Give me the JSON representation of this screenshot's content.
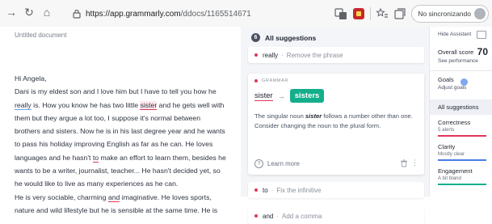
{
  "browser": {
    "url_host": "https://app.grammarly.com",
    "url_path": "/ddocs/1165514671",
    "sync_label": "No sincronizando"
  },
  "document": {
    "title": "Untitled document",
    "lines": [
      {
        "segs": [
          {
            "t": "Hi Angela,"
          }
        ]
      },
      {
        "segs": [
          {
            "t": "Dani is my eldest son and I love him but I have to tell you how he"
          }
        ]
      },
      {
        "segs": [
          {
            "t": "really",
            "u": "blue"
          },
          {
            "t": " is. How you know he has two little "
          },
          {
            "t": "sister",
            "u": "hl"
          },
          {
            "t": " and he gets well with"
          }
        ]
      },
      {
        "segs": [
          {
            "t": "them but they argue a lot too, I suppose it's normal between"
          }
        ]
      },
      {
        "segs": [
          {
            "t": "brothers and sisters. Now he is in his last degree year and he wants"
          }
        ]
      },
      {
        "segs": [
          {
            "t": "to pass his holiday improving English as far as he can. He loves"
          }
        ]
      },
      {
        "segs": [
          {
            "t": "languages and he hasn't "
          },
          {
            "t": "to",
            "u": "red"
          },
          {
            "t": " make an effort to learn them, besides he"
          }
        ]
      },
      {
        "segs": [
          {
            "t": "wants to be a writer, journalist, teacher... He hasn't decided yet, so"
          }
        ]
      },
      {
        "segs": [
          {
            "t": "he would like to live as many experiences as he can."
          }
        ]
      },
      {
        "segs": [
          {
            "t": "He is very sociable, charming "
          },
          {
            "t": "and",
            "u": "red"
          },
          {
            "t": " imaginative. He loves sports,"
          }
        ]
      },
      {
        "segs": [
          {
            "t": "nature and wild lifestyle but he is sensible at the same time. He is"
          }
        ]
      }
    ]
  },
  "suggestions": {
    "count": "6",
    "header": "All suggestions",
    "top_card": {
      "word": "really",
      "sep": "·",
      "desc": "Remove the phrase"
    },
    "main_card": {
      "category": "GRAMMAR",
      "from": "sister",
      "arrow": "→",
      "to": "sisters",
      "expl_pre": "The singular noun ",
      "expl_bold": "sister",
      "expl_post": " follows a number other than one. Consider changing the noun to the plural form.",
      "learn_more": "Learn more",
      "kebab": "⋮"
    },
    "card_to": {
      "word": "to",
      "sep": "·",
      "desc": "Fix the infinitive"
    },
    "card_and": {
      "word": "and",
      "sep": "·",
      "desc": "Add a comma"
    }
  },
  "assistant": {
    "hide_label": "Hide Assistant",
    "overall_label": "Overall score",
    "overall_value": "70",
    "see_performance": "See performance",
    "goals_label": "Goals",
    "goals_adjust": "Adjust goals",
    "all_suggestions": "All suggestions",
    "metrics": [
      {
        "name": "Correctness",
        "sub": "5 alerts",
        "color": "#e0365a"
      },
      {
        "name": "Clarity",
        "sub": "Mostly clear",
        "color": "#4a7ee6"
      },
      {
        "name": "Engagement",
        "sub": "A bit bland",
        "color": "#14ae8b"
      }
    ]
  },
  "colors": {
    "accent_red": "#e0365a",
    "accent_green": "#14ae8b",
    "accent_blue": "#4a7ee6"
  }
}
